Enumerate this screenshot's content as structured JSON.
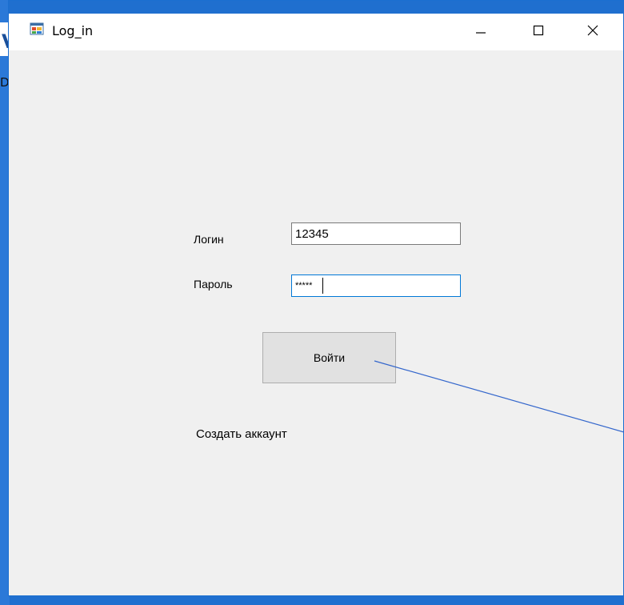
{
  "window": {
    "title": "Log_in"
  },
  "form": {
    "login_label": "Логин",
    "login_value": "12345",
    "password_label": "Пароль",
    "password_value": "*****",
    "login_button": "Войти",
    "create_account_link": "Создать аккаунт"
  },
  "background_app": {
    "glyph_top": "V",
    "glyph_mid": "D"
  },
  "colors": {
    "accent": "#1f6fcf",
    "window_bg": "#f0f0f0",
    "button_bg": "#e1e1e1",
    "focus_border": "#0078d7",
    "annotation_line": "#3366cc"
  },
  "icons": {
    "app": "winforms-app-icon",
    "minimize": "minimize-icon",
    "maximize": "maximize-icon",
    "close": "close-icon"
  }
}
